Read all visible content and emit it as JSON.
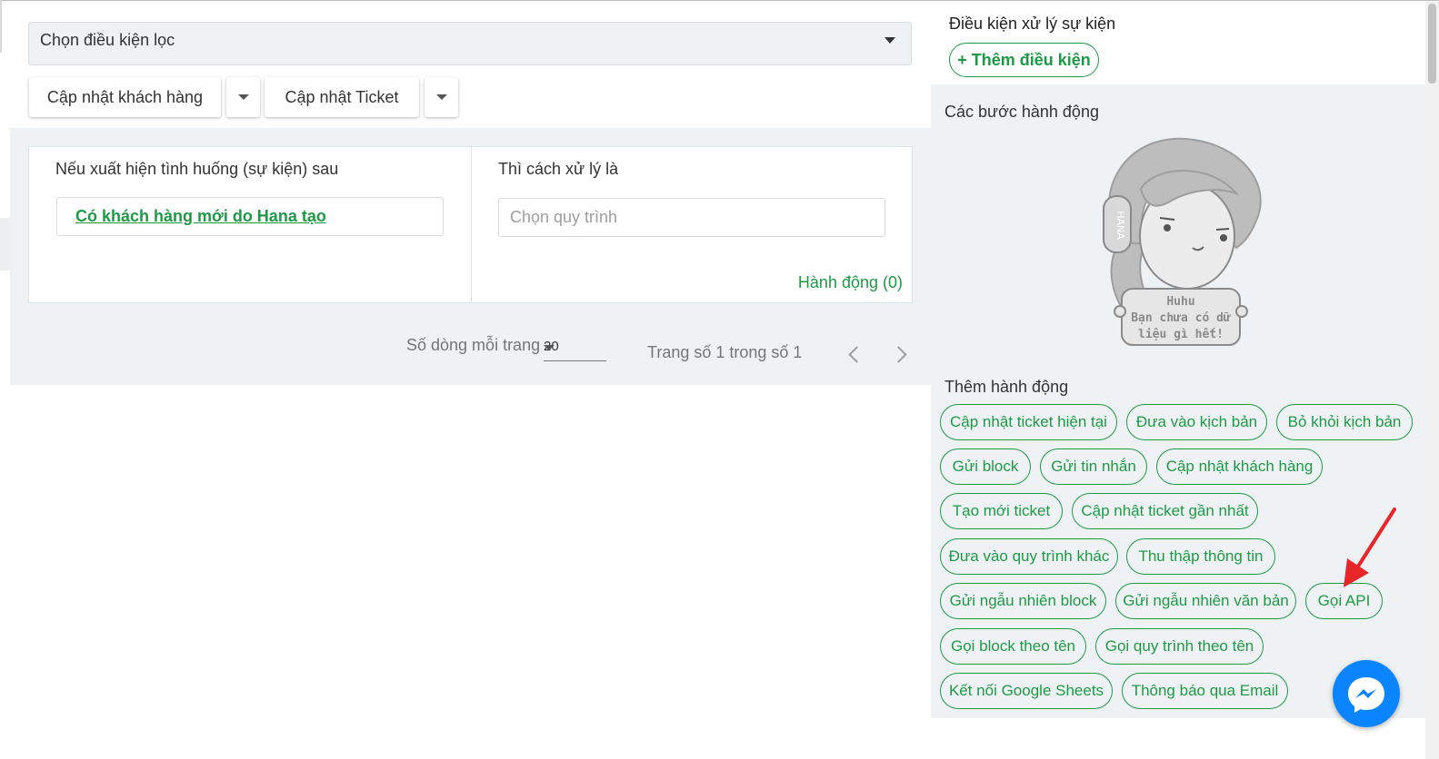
{
  "filter": {
    "placeholder": "Chọn điều kiện lọc"
  },
  "toolbar": {
    "update_customer": "Cập nhật khách hàng",
    "update_ticket": "Cập nhật Ticket"
  },
  "rule": {
    "trigger_header": "Nếu xuất hiện tình huống (sự kiện) sau",
    "trigger_value": "Có khách hàng mới do Hana tạo",
    "process_header": "Thì cách xử lý là",
    "process_placeholder": "Chọn quy trình",
    "actions_link": "Hành động (0)"
  },
  "pagination": {
    "rows_label": "Số dòng mỗi trang",
    "rows_value": "20",
    "page_info": "Trang số 1 trong số 1"
  },
  "panel": {
    "conditions_title": "Điều kiện xử lý sự kiện",
    "add_condition": "+ Thêm điều kiện",
    "steps_title": "Các bước hành động",
    "empty_line1": "Huhu",
    "empty_line2": "Bạn chưa có dữ",
    "empty_line3": "liệu gì hết!",
    "add_action_title": "Thêm hành động",
    "actions": [
      "Cập nhật ticket hiện tại",
      "Đưa vào kịch bản",
      "Bỏ khỏi kịch bản",
      "Gửi block",
      "Gửi tin nhắn",
      "Cập nhật khách hàng",
      "Tạo mới ticket",
      "Cập nhật ticket gần nhất",
      "Đưa vào quy trình khác",
      "Thu thập thông tin",
      "Gửi ngẫu nhiên block",
      "Gửi ngẫu nhiên văn bản",
      "Gọi API",
      "Gọi block theo tên",
      "Gọi quy trình theo tên",
      "Kết nối Google Sheets",
      "Thông báo qua Email"
    ]
  },
  "colors": {
    "accent": "#1e9a46",
    "annotation_arrow": "#e8262a",
    "messenger": "#0b84ff"
  },
  "icons": [
    "caret-down-icon",
    "chevron-left-icon",
    "chevron-right-icon",
    "messenger-icon",
    "red-arrow-annotation"
  ]
}
